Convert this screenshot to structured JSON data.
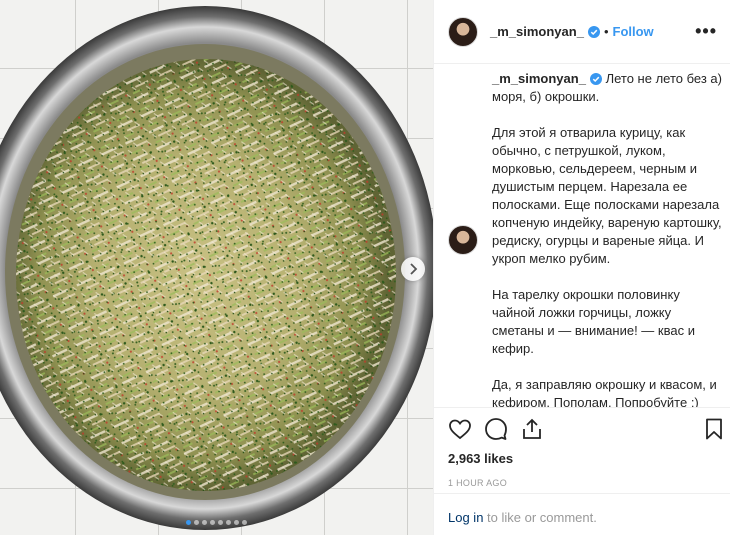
{
  "post": {
    "username": "_m_simonyan_",
    "separator": "•",
    "follow_label": "Follow",
    "more_label": "•••",
    "caption": "Лето не лето без а) моря, б) окрошки.\n\nДля этой я отварила курицу, как обычно, с петрушкой, луком, морковью, сельдереем, черным и душистым перцем. Нарезала ее полосками. Еще полосками нарезала копченую индейку, вареную картошку, редиску, огурцы и вареные яйца. И укроп мелко рубим.\n\nНа тарелку окрошки половинку чайной ложки горчицы, ложку сметаны и — внимание! — квас и кефир.\n\nДа, я заправляю окрошку и квасом, и кефиром. Пополам. Попробуйте :)",
    "likes": "2,963 likes",
    "time": "1 HOUR AGO",
    "login_link": "Log in",
    "login_suffix": " to like or comment.",
    "carousel_count": 8,
    "carousel_active": 0
  },
  "icons": {
    "verified": "verified-badge-icon",
    "like": "heart-icon",
    "comment": "comment-bubble-icon",
    "share": "share-icon",
    "save": "bookmark-icon",
    "next": "chevron-right-icon"
  },
  "colors": {
    "accent": "#3897f0",
    "link": "#003569",
    "muted": "#999999",
    "text": "#262626",
    "border": "#efefef"
  }
}
